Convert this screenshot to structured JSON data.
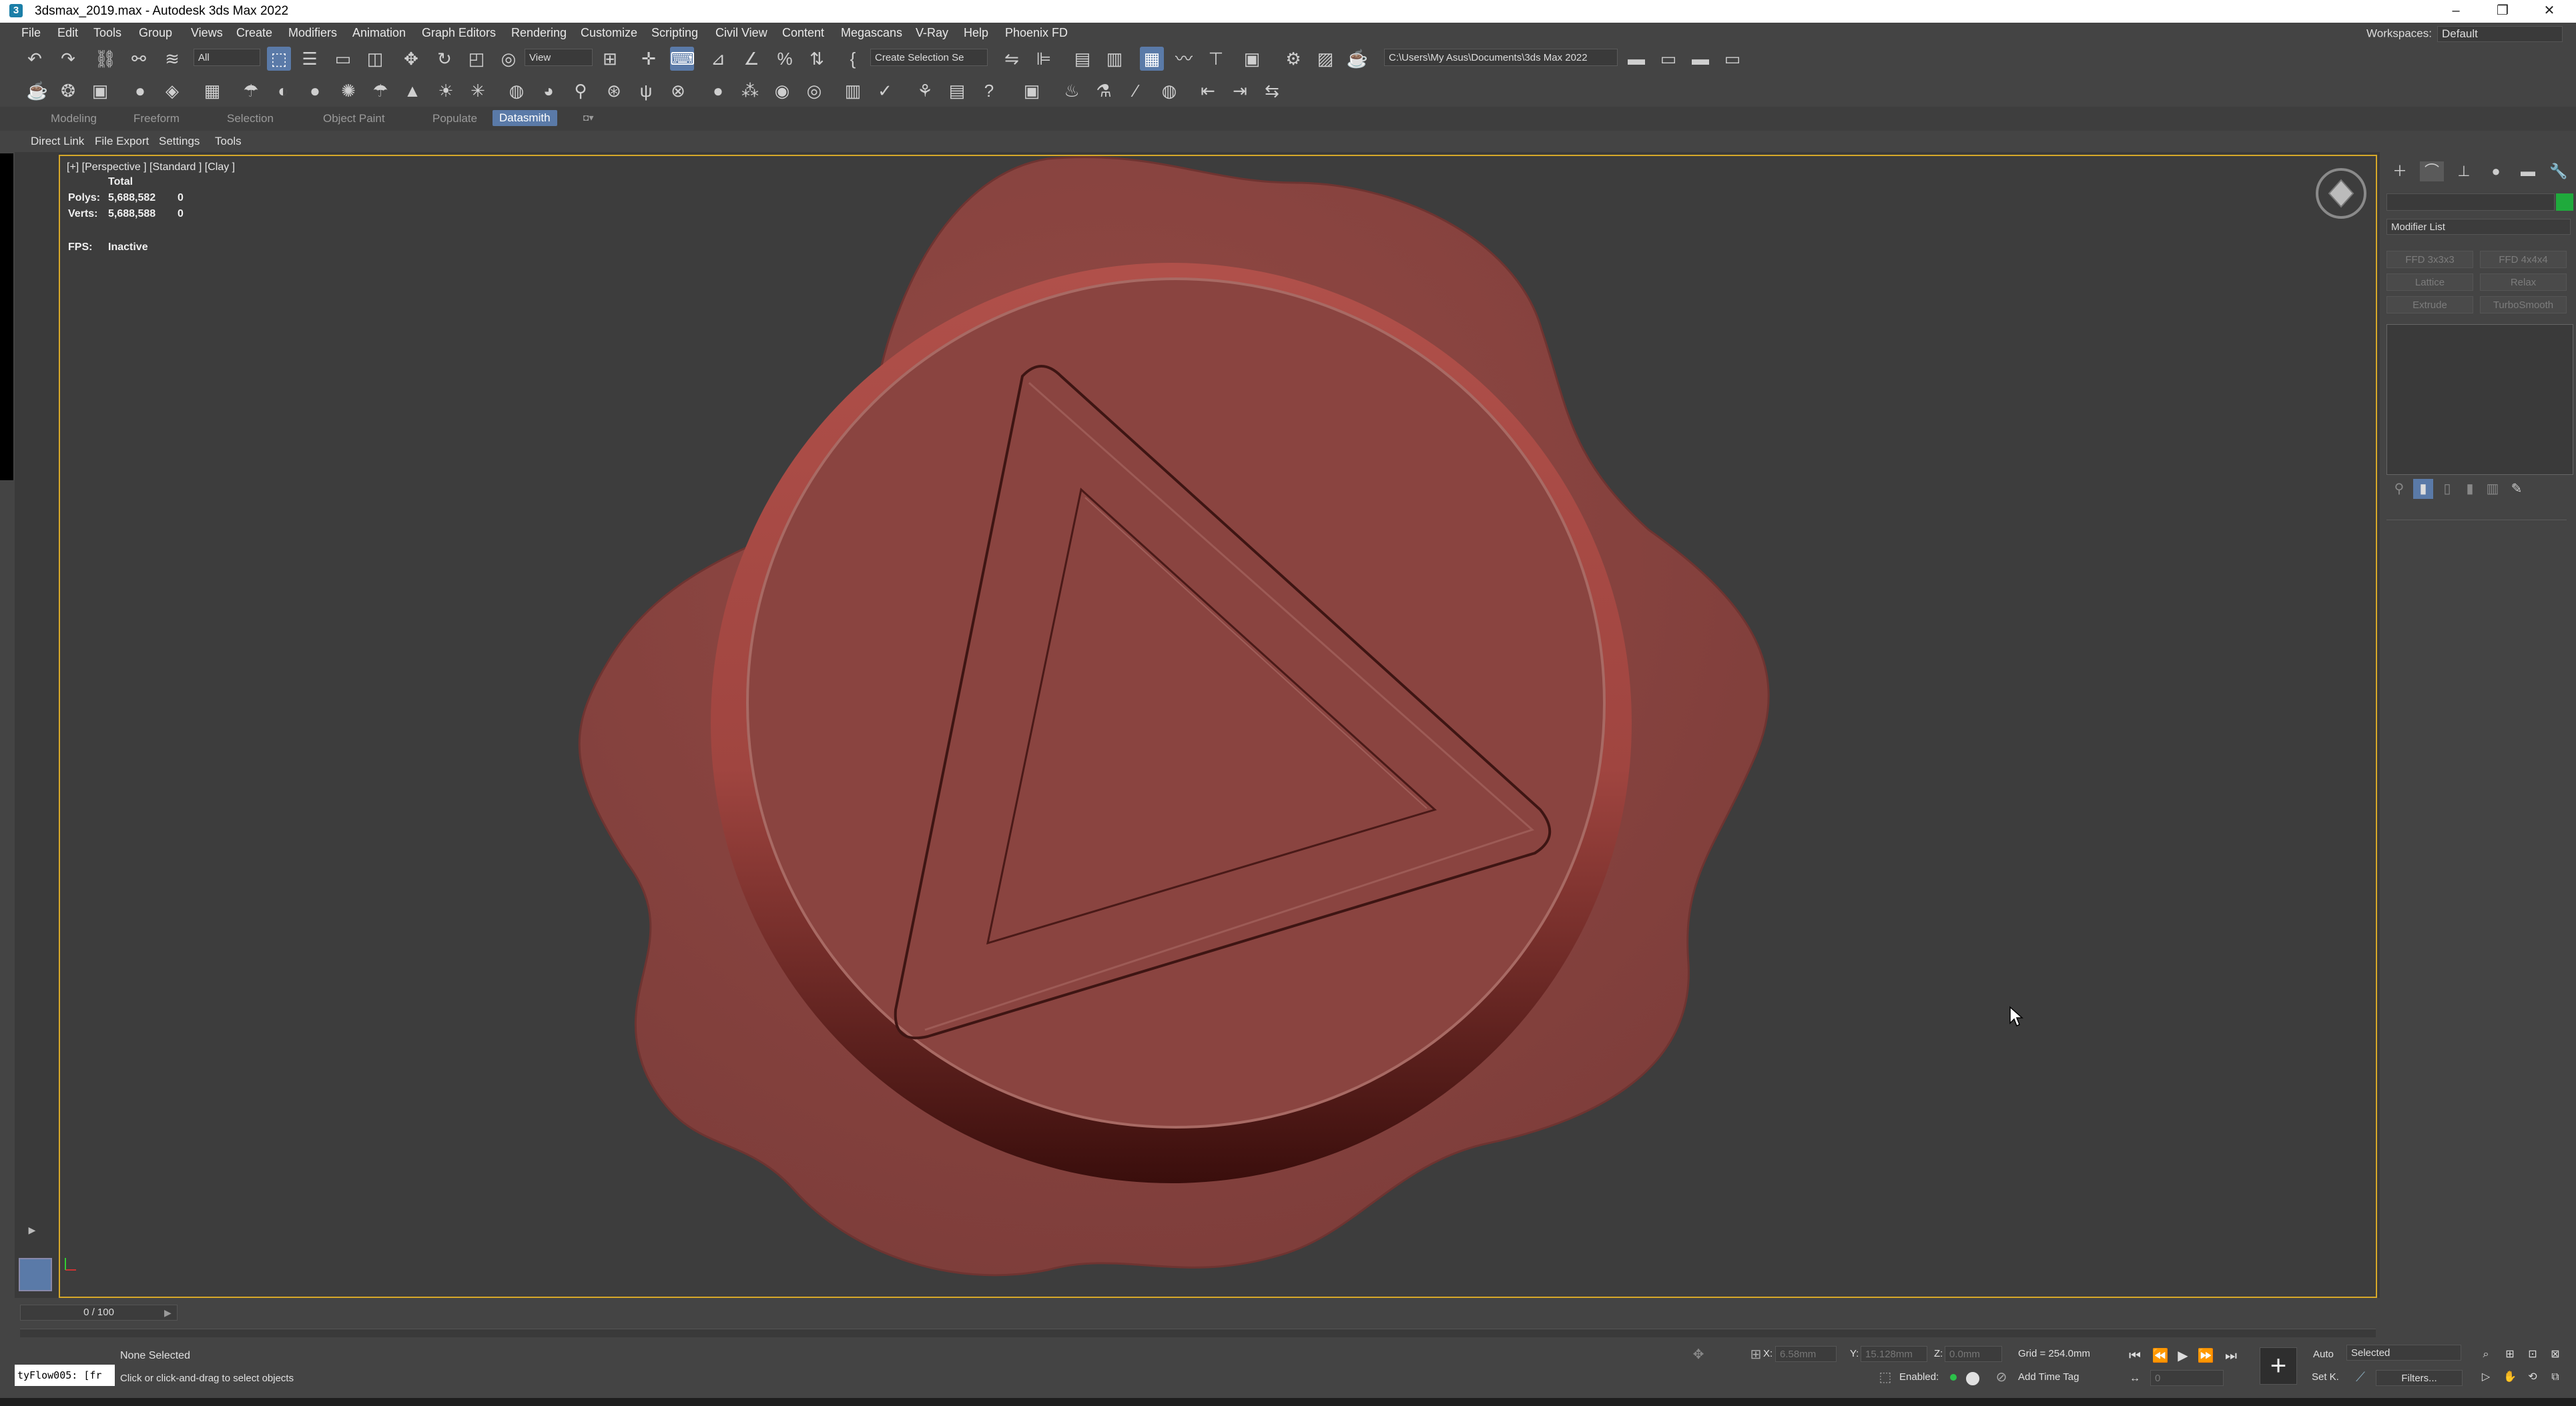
{
  "window": {
    "title": "3dsmax_2019.max - Autodesk 3ds Max 2022",
    "icon": "3",
    "minimize": "–",
    "maximize": "❐",
    "close": "✕"
  },
  "menu": {
    "items": [
      "File",
      "Edit",
      "Tools",
      "Group",
      "Views",
      "Create",
      "Modifiers",
      "Animation",
      "Graph Editors",
      "Rendering",
      "Customize",
      "Scripting",
      "Civil View",
      "Content",
      "Megascans",
      "V-Ray",
      "Help",
      "Phoenix FD"
    ],
    "workspace_label": "Workspaces:",
    "workspace_value": "Default"
  },
  "toolbar": {
    "selection_filter": "All",
    "ref_coord": "View",
    "named_selection": "Create Selection Se",
    "project_path": "C:\\Users\\My Asus\\Documents\\3ds Max 2022"
  },
  "ribbon": {
    "tabs": [
      "Modeling",
      "Freeform",
      "Selection",
      "Object Paint",
      "Populate",
      "Datasmith"
    ],
    "active": "Datasmith"
  },
  "scene_explorer": {
    "tabs": [
      "Direct Link",
      "File Export",
      "Settings",
      "Tools"
    ]
  },
  "viewport": {
    "label": "[+] [Perspective ] [Standard ] [Clay ]",
    "stats": {
      "total_label": "Total",
      "polys_label": "Polys:",
      "polys_value": "5,688,582",
      "polys_sel": "0",
      "verts_label": "Verts:",
      "verts_value": "5,688,588",
      "verts_sel": "0",
      "fps_label": "FPS:",
      "fps_value": "Inactive"
    },
    "model_color": "#8a4440"
  },
  "command_panel": {
    "modifier_list": "Modifier List",
    "buttons": [
      "FFD 3x3x3",
      "FFD 4x4x4",
      "Lattice",
      "Relax",
      "Extrude",
      "TurboSmooth"
    ],
    "object_color": "#1faa3c"
  },
  "status": {
    "time_slider": "0 / 100",
    "selection_status": "None Selected",
    "prompt": "Click or click-and-drag to select objects",
    "maxscript": "tyFlow005: [fr",
    "x_label": "X:",
    "x_value": "6.58mm",
    "y_label": "Y:",
    "y_value": "15.128mm",
    "z_label": "Z:",
    "z_value": "0.0mm",
    "grid": "Grid = 254.0mm",
    "enabled_label": "Enabled:",
    "add_time_tag": "Add Time Tag",
    "auto_key": "Auto",
    "set_key": "Set K.",
    "key_filter": "Selected",
    "filters": "Filters...",
    "frame_value": "0"
  }
}
